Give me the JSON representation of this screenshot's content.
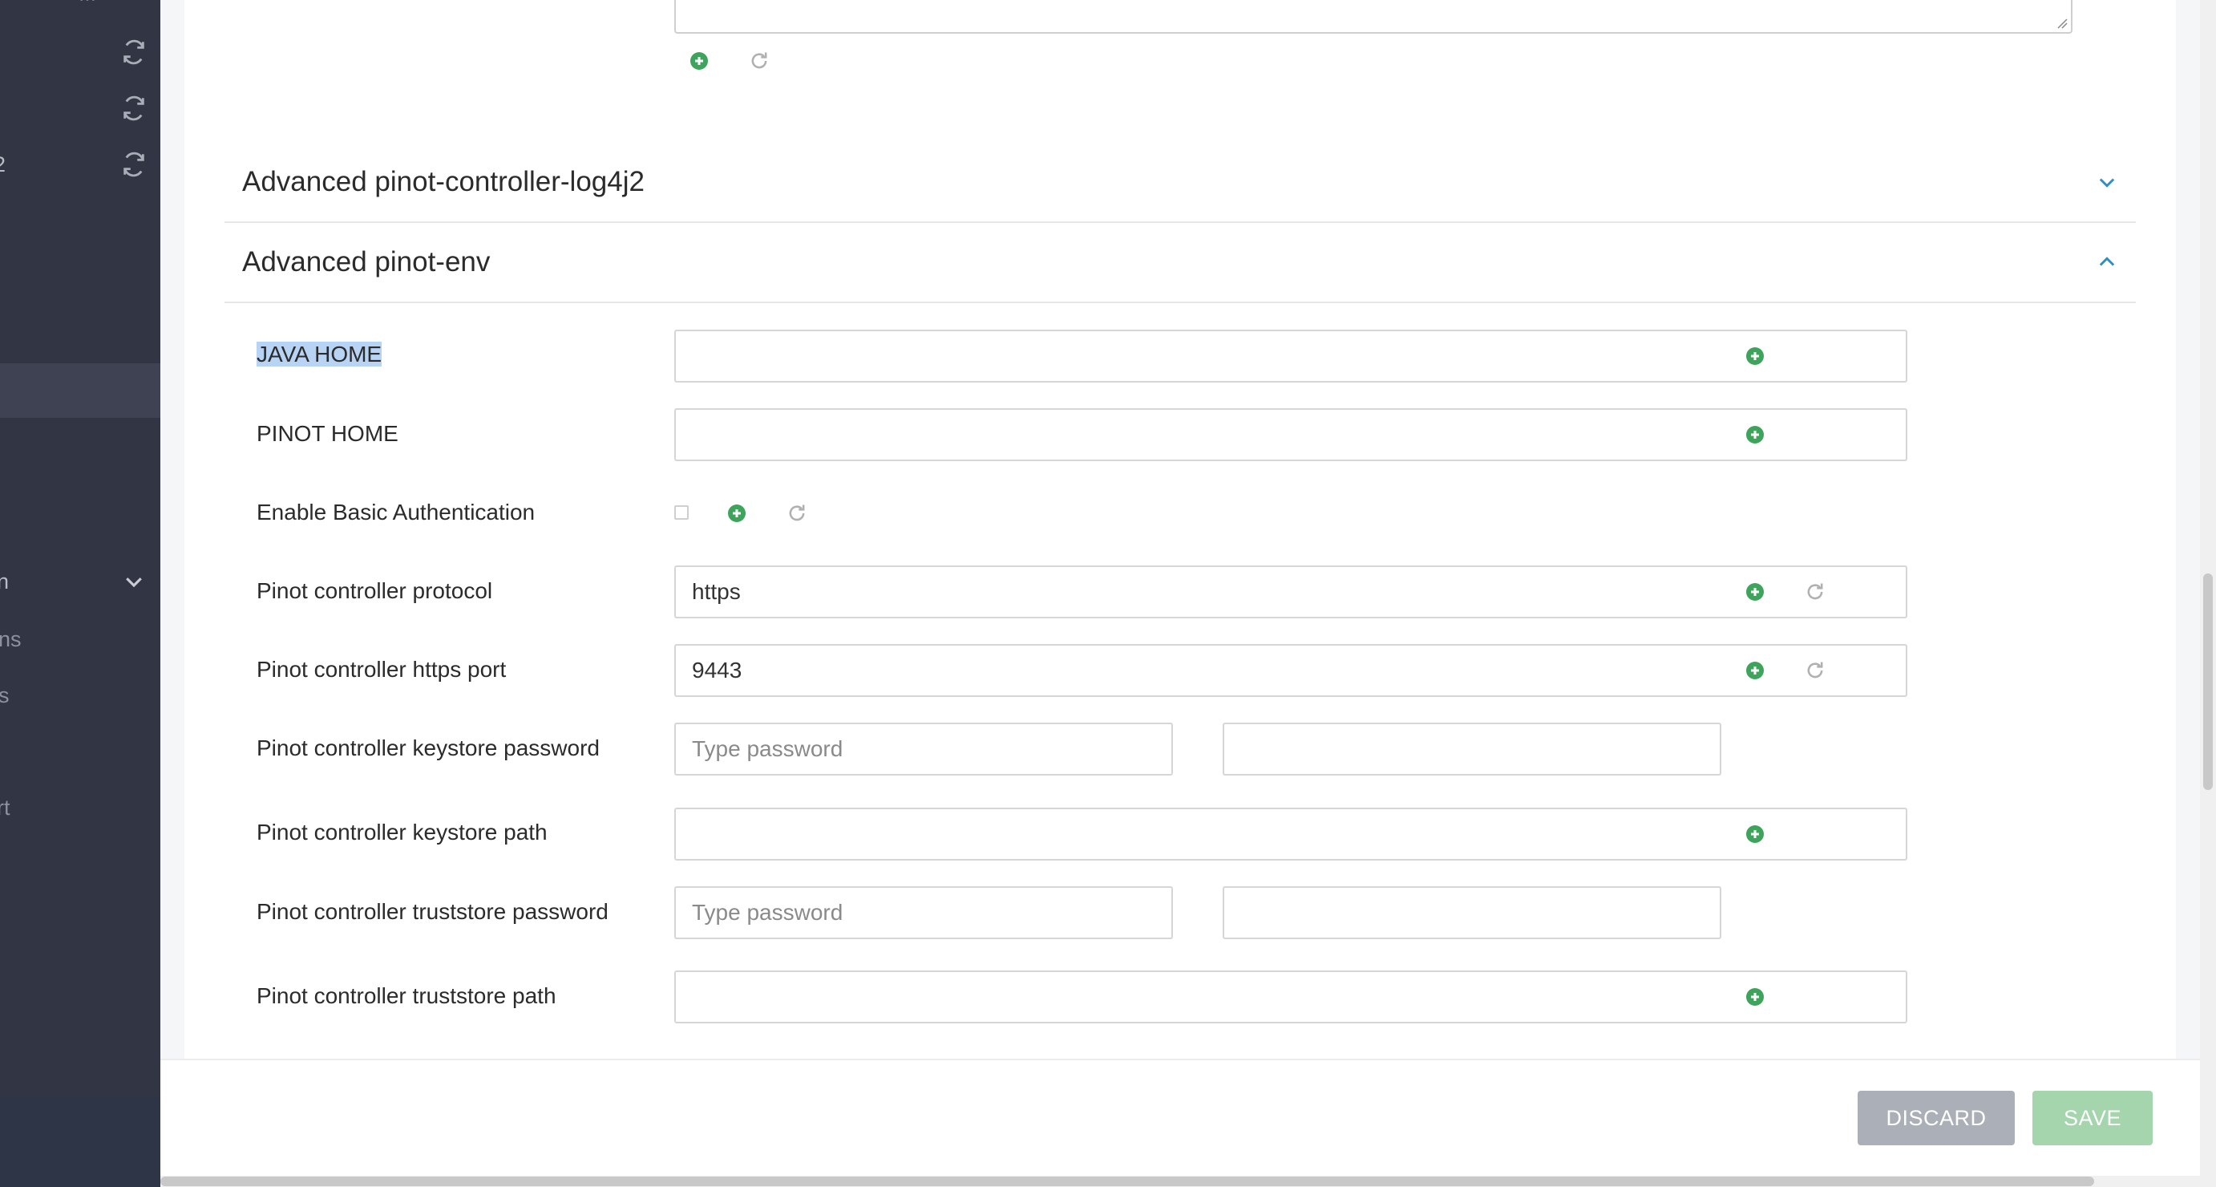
{
  "sidebar": {
    "fragments": [
      {
        "text": "2"
      },
      {
        "text": "n"
      },
      {
        "text": "ns"
      },
      {
        "text": "s"
      },
      {
        "text": "rt"
      }
    ]
  },
  "sections": {
    "collapsed_title": "Advanced pinot-controller-log4j2",
    "expanded_title": "Advanced pinot-env"
  },
  "form": {
    "java_home": {
      "label": "JAVA HOME",
      "value": ""
    },
    "pinot_home": {
      "label": "PINOT HOME",
      "value": ""
    },
    "basic_auth": {
      "label": "Enable Basic Authentication",
      "checked": false
    },
    "protocol": {
      "label": "Pinot controller protocol",
      "value": "https"
    },
    "https_port": {
      "label": "Pinot controller https port",
      "value": "9443"
    },
    "keystore_password": {
      "label": "Pinot controller keystore password",
      "placeholder": "Type password",
      "confirm_value": ""
    },
    "keystore_path": {
      "label": "Pinot controller keystore path",
      "value": ""
    },
    "truststore_password": {
      "label": "Pinot controller truststore password",
      "placeholder": "Type password",
      "confirm_value": ""
    },
    "truststore_path": {
      "label": "Pinot controller truststore path",
      "value": ""
    }
  },
  "footer": {
    "discard_label": "DISCARD",
    "save_label": "SAVE"
  },
  "colors": {
    "sidebar_bg": "#323544",
    "add_icon": "#3fa45b",
    "save_button": "#a4d5ac",
    "discard_button": "#abb0b8",
    "accent_chevron": "#2e8fc4"
  },
  "icons": [
    "refresh-icon",
    "add-icon",
    "undo-icon",
    "chevron-down-icon",
    "chevron-up-icon"
  ]
}
